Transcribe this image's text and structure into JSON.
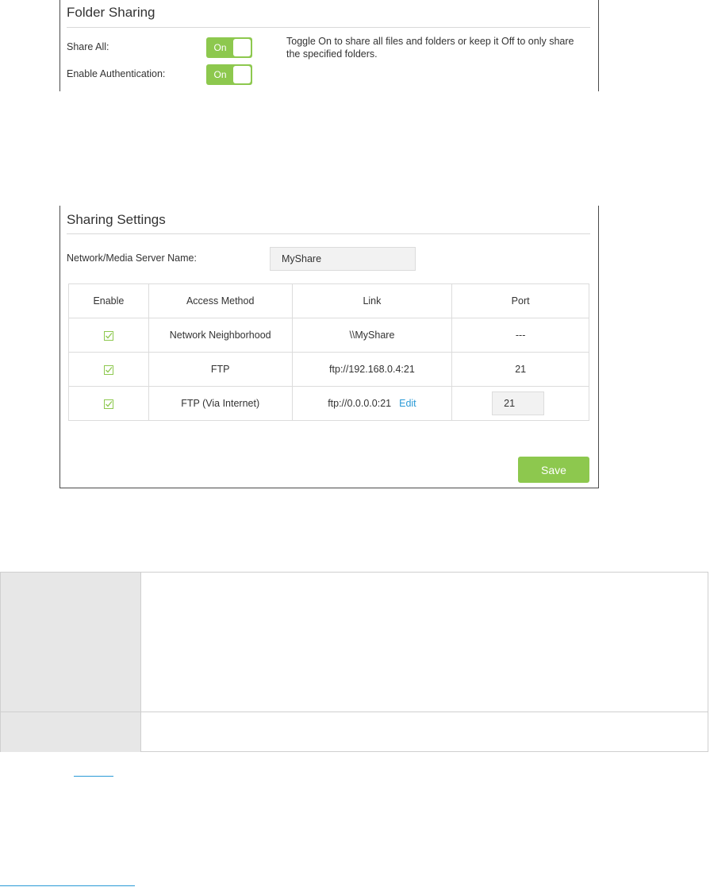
{
  "folder_sharing": {
    "title": "Folder Sharing",
    "share_all_label": "Share All:",
    "share_all_state": "On",
    "auth_label": "Enable Authentication:",
    "auth_state": "On",
    "note": "Toggle On to share all files and folders or keep it Off to only share the specified folders."
  },
  "sharing_settings": {
    "title": "Sharing Settings",
    "server_name_label": "Network/Media Server Name:",
    "server_name_value": "MyShare",
    "columns": [
      "Enable",
      "Access Method",
      "Link",
      "Port"
    ],
    "rows": [
      {
        "enabled": true,
        "method": "Network Neighborhood",
        "link": "\\\\MyShare",
        "port": "---"
      },
      {
        "enabled": true,
        "method": "FTP",
        "link": "ftp://192.168.0.4:21",
        "port": "21"
      },
      {
        "enabled": true,
        "method": "FTP (Via Internet)",
        "link": "ftp://0.0.0.0:21",
        "edit_label": "Edit",
        "port": "21"
      }
    ],
    "save_label": "Save"
  },
  "colors": {
    "accent_green": "#8dc84e",
    "link_blue": "#2a9ad6",
    "panel_border": "#4a4a4a"
  }
}
